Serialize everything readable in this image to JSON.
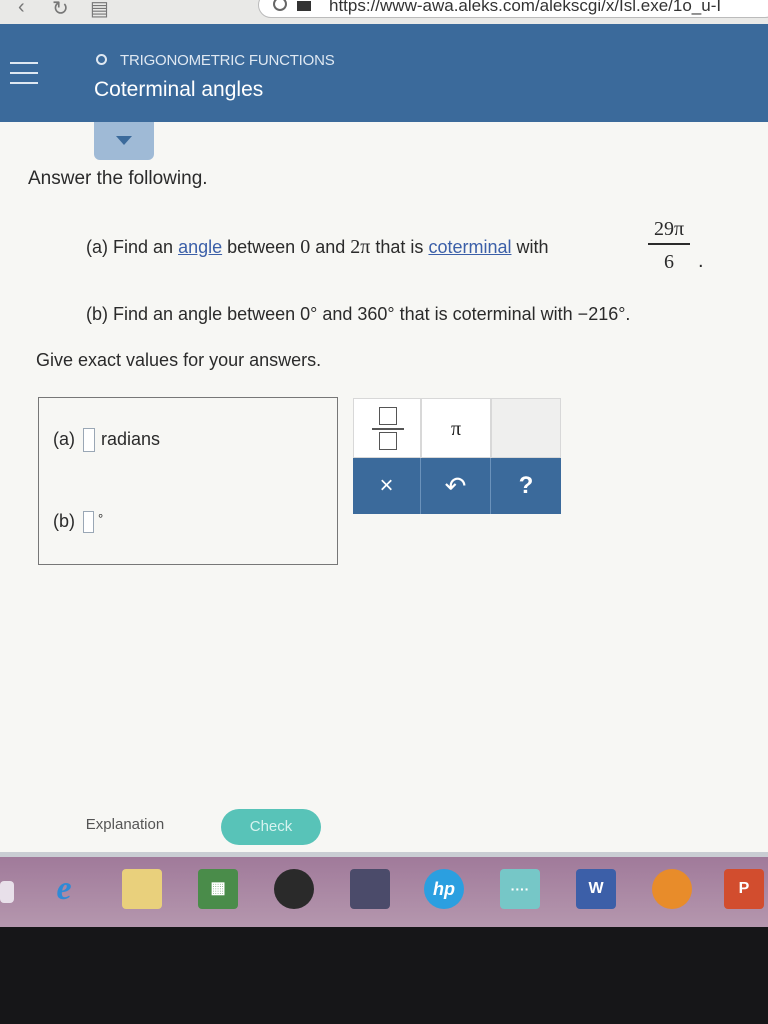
{
  "browser": {
    "url": "https://www-awa.aleks.com/alekscgi/x/Isl.exe/1o_u-I"
  },
  "header": {
    "topic": "TRIGONOMETRIC FUNCTIONS",
    "title": "Coterminal angles"
  },
  "question": {
    "prompt": "Answer the following.",
    "part_a": {
      "label": "(a) Find an",
      "link_angle": "angle",
      "between": "between",
      "low": "0",
      "and": "and",
      "high": "2π",
      "that_is": "that is",
      "link_coterminal": "coterminal",
      "with": "with",
      "numerator": "29π",
      "denominator": "6",
      "period": "."
    },
    "part_b": {
      "text": "(b) Find an angle between 0° and 360° that is coterminal with −216°."
    },
    "instruction": "Give exact values for your answers."
  },
  "answers": {
    "a_label": "(a)",
    "a_unit": "radians",
    "b_label": "(b)",
    "b_unit": "°"
  },
  "keypad": {
    "pi": "π",
    "clear": "×",
    "undo": "↶",
    "help": "?"
  },
  "buttons": {
    "explanation": "Explanation",
    "check": "Check"
  },
  "taskbar": {
    "ie": "e",
    "store": "▦",
    "hp": "hp",
    "net": "····",
    "word": "W",
    "ppt": "P"
  },
  "colors": {
    "header_bg": "#3b6a9b",
    "link": "#3b5fa8",
    "check_button": "#58c3b8",
    "keypad_action": "#3b6a9b"
  }
}
